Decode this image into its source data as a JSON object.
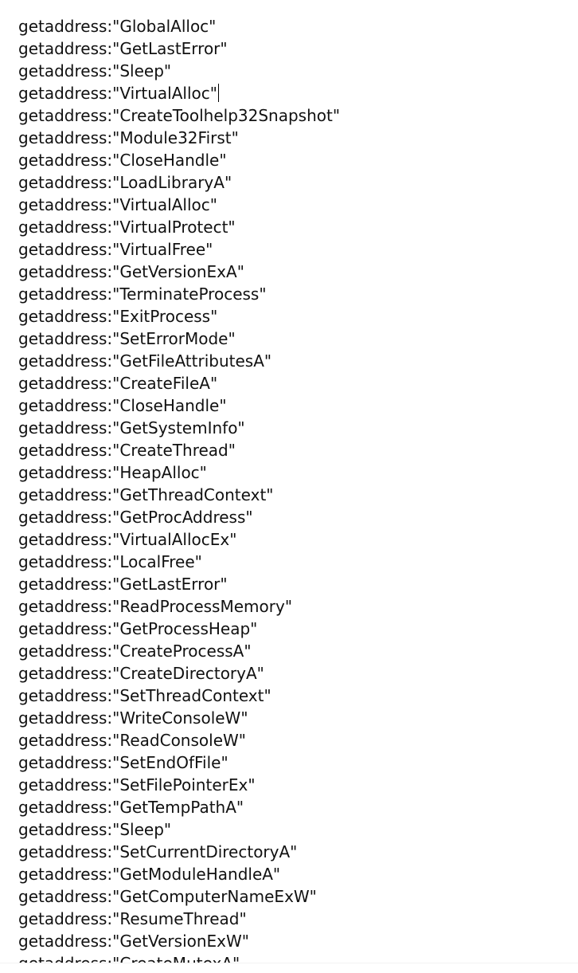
{
  "editor": {
    "lines": [
      "getaddress:\"GlobalAlloc\"",
      "getaddress:\"GetLastError\"",
      "getaddress:\"Sleep\"",
      "getaddress:\"VirtualAlloc\"",
      "getaddress:\"CreateToolhelp32Snapshot\"",
      "getaddress:\"Module32First\"",
      "getaddress:\"CloseHandle\"",
      "getaddress:\"LoadLibraryA\"",
      "getaddress:\"VirtualAlloc\"",
      "getaddress:\"VirtualProtect\"",
      "getaddress:\"VirtualFree\"",
      "getaddress:\"GetVersionExA\"",
      "getaddress:\"TerminateProcess\"",
      "getaddress:\"ExitProcess\"",
      "getaddress:\"SetErrorMode\"",
      "getaddress:\"GetFileAttributesA\"",
      "getaddress:\"CreateFileA\"",
      "getaddress:\"CloseHandle\"",
      "getaddress:\"GetSystemInfo\"",
      "getaddress:\"CreateThread\"",
      "getaddress:\"HeapAlloc\"",
      "getaddress:\"GetThreadContext\"",
      "getaddress:\"GetProcAddress\"",
      "getaddress:\"VirtualAllocEx\"",
      "getaddress:\"LocalFree\"",
      "getaddress:\"GetLastError\"",
      "getaddress:\"ReadProcessMemory\"",
      "getaddress:\"GetProcessHeap\"",
      "getaddress:\"CreateProcessA\"",
      "getaddress:\"CreateDirectoryA\"",
      "getaddress:\"SetThreadContext\"",
      "getaddress:\"WriteConsoleW\"",
      "getaddress:\"ReadConsoleW\"",
      "getaddress:\"SetEndOfFile\"",
      "getaddress:\"SetFilePointerEx\"",
      "getaddress:\"GetTempPathA\"",
      "getaddress:\"Sleep\"",
      "getaddress:\"SetCurrentDirectoryA\"",
      "getaddress:\"GetModuleHandleA\"",
      "getaddress:\"GetComputerNameExW\"",
      "getaddress:\"ResumeThread\"",
      "getaddress:\"GetVersionExW\"",
      "getaddress:\"CreateMutexA\""
    ]
  }
}
